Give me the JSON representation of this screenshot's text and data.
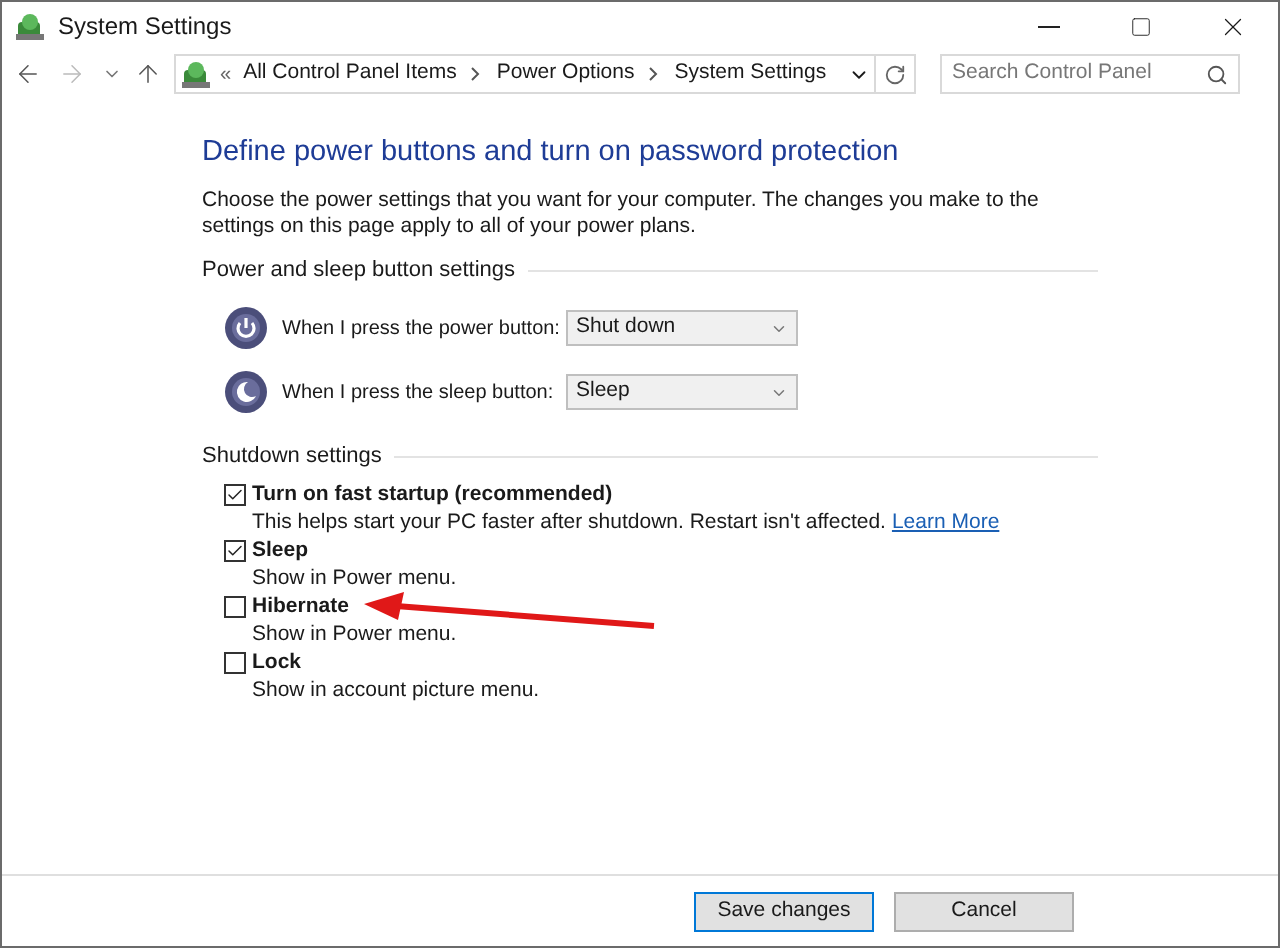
{
  "window": {
    "title": "System Settings"
  },
  "address_bar": {
    "prefix": "«",
    "breadcrumbs": [
      "All Control Panel Items",
      "Power Options",
      "System Settings"
    ]
  },
  "search": {
    "placeholder": "Search Control Panel"
  },
  "heading": "Define power buttons and turn on password protection",
  "description": "Choose the power settings that you want for your computer. The changes you make to the settings on this page apply to all of your power plans.",
  "button_section": {
    "title": "Power and sleep button settings",
    "rows": [
      {
        "kind": "power",
        "label": "When I press the power button:",
        "value": "Shut down"
      },
      {
        "kind": "sleep",
        "label": "When I press the sleep button:",
        "value": "Sleep"
      }
    ]
  },
  "shutdown_section": {
    "title": "Shutdown settings",
    "options": [
      {
        "label": "Turn on fast startup (recommended)",
        "checked": true,
        "description": "This helps start your PC faster after shutdown. Restart isn't affected.",
        "link": "Learn More"
      },
      {
        "label": "Sleep",
        "checked": true,
        "description": "Show in Power menu."
      },
      {
        "label": "Hibernate",
        "checked": false,
        "description": "Show in Power menu.",
        "arrow_annotation": true
      },
      {
        "label": "Lock",
        "checked": false,
        "description": "Show in account picture menu."
      }
    ]
  },
  "buttons": [
    {
      "label": "Save changes",
      "default": true
    },
    {
      "label": "Cancel",
      "default": false
    }
  ]
}
